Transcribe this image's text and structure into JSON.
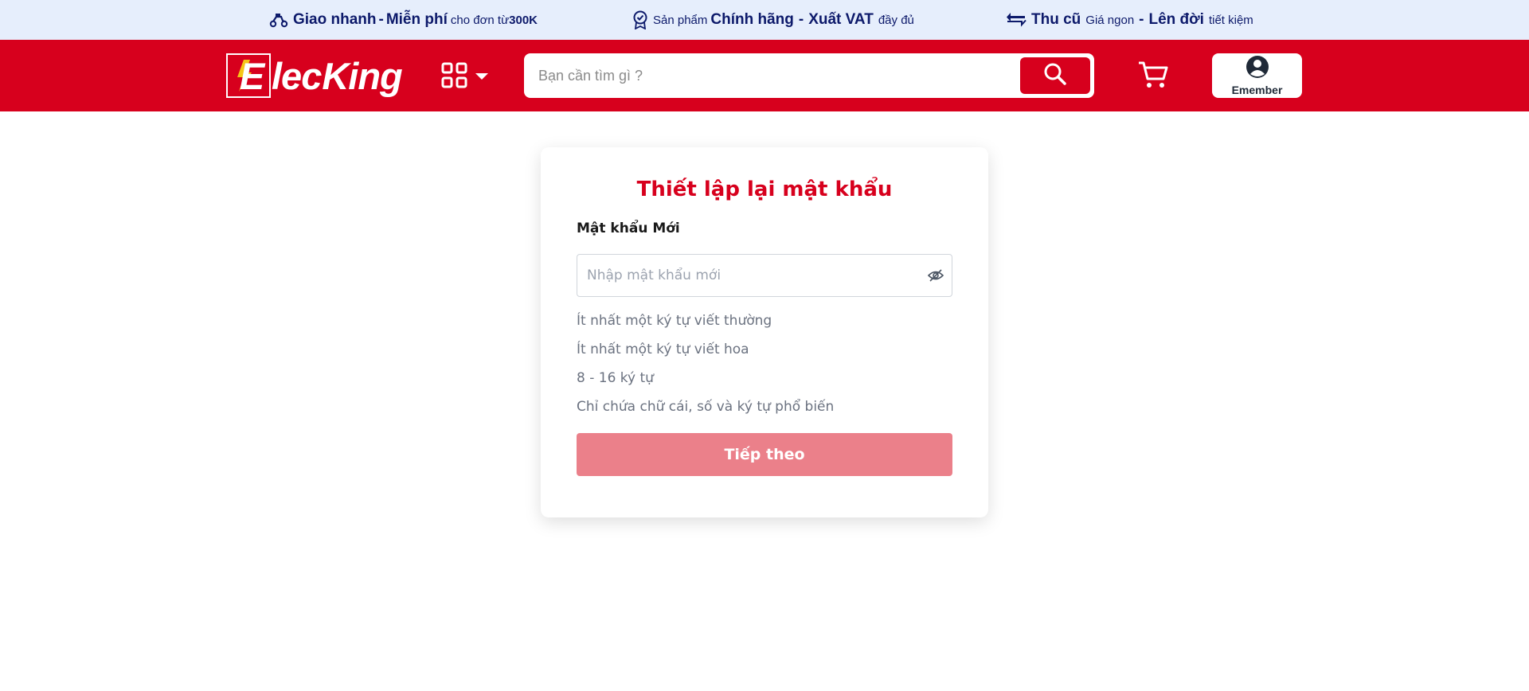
{
  "promo": [
    {
      "icon": "delivery-scooter-icon",
      "b1": "Giao nhanh",
      "sep": "-",
      "b2": "Miễn phí",
      "s1": "cho đơn từ ",
      "b3": "300K"
    },
    {
      "icon": "certified-badge-icon",
      "s1": "Sản phẩm ",
      "b1": "Chính hãng",
      "sep": "-",
      "b2": "Xuất VAT",
      "s2": "đầy đủ"
    },
    {
      "icon": "exchange-arrows-icon",
      "b1": "Thu cũ",
      "s1": "Giá ngon",
      "sep": "-",
      "b2": "Lên đời",
      "s2": "tiết kiệm"
    }
  ],
  "header": {
    "logo_text": "lec",
    "logo_text_2": "King",
    "logo_letter": "E",
    "search_placeholder": "Bạn cần tìm gì ?",
    "member_label": "Emember"
  },
  "form": {
    "title": "Thiết lập lại mật khẩu",
    "field_label": "Mật khẩu Mới",
    "field_placeholder": "Nhập mật khẩu mới",
    "rules": [
      "Ít nhất một ký tự viết thường",
      "Ít nhất một ký tự viết hoa",
      "8 - 16 ký tự",
      "Chỉ chứa chữ cái, số và ký tự phổ biến"
    ],
    "submit_label": "Tiếp theo"
  },
  "colors": {
    "brand_red": "#d7001d",
    "promo_bg": "#e6eefc",
    "promo_text": "#0d1a6b",
    "button_disabled": "#eb808a"
  }
}
